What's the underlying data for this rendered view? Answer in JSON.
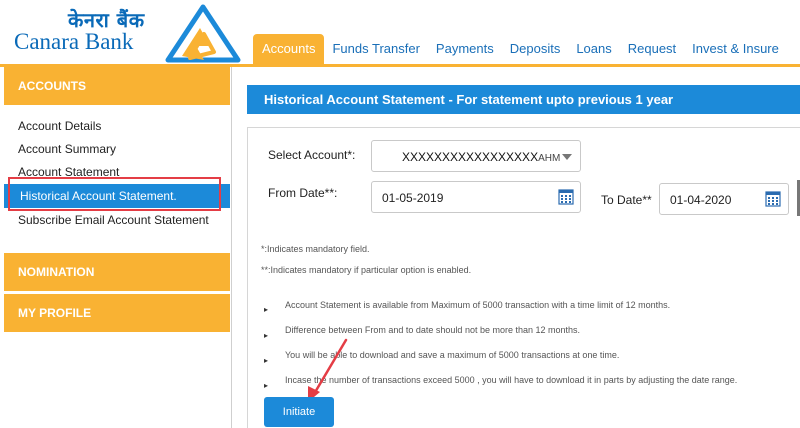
{
  "brand": {
    "name_hindi": "केनरा बैंक",
    "name_en": "Canara Bank",
    "colors": {
      "primary": "#1c8ad9",
      "accent": "#f9b233",
      "text_blue": "#0a6ab8",
      "highlight_red": "#e43d45"
    }
  },
  "nav": {
    "items": [
      {
        "label": "Accounts",
        "active": true
      },
      {
        "label": "Funds Transfer",
        "active": false
      },
      {
        "label": "Payments",
        "active": false
      },
      {
        "label": "Deposits",
        "active": false
      },
      {
        "label": "Loans",
        "active": false
      },
      {
        "label": "Request",
        "active": false
      },
      {
        "label": "Invest & Insure",
        "active": false
      }
    ]
  },
  "sidebar": {
    "accounts_header": "ACCOUNTS",
    "items": [
      {
        "label": "Account Details"
      },
      {
        "label": "Account Summary"
      },
      {
        "label": "Account Statement"
      },
      {
        "label": "Historical Account Statement.",
        "active": true
      },
      {
        "label": "Subscribe Email Account Statement"
      }
    ],
    "nomination_header": "NOMINATION",
    "profile_header": "MY PROFILE"
  },
  "main": {
    "title": "Historical Account Statement - For statement upto previous 1 year",
    "select_account_label": "Select Account*:",
    "select_account_value": "XXXXXXXXXXXXXXXXX",
    "select_account_suffix": "AHM",
    "from_date_label": "From Date**:",
    "from_date_value": "01-05-2019",
    "to_date_label": "To Date**",
    "to_date_value": "01-04-2020",
    "notes": [
      "*:Indicates mandatory field.",
      "**:Indicates mandatory if particular option is enabled."
    ],
    "bullets": [
      "Account Statement is available from Maximum of 5000 transaction with a time limit of 12 months.",
      "Difference between From and to date should not be more than 12 months.",
      "You will be able to download and save a maximum of 5000 transactions at one time.",
      "Incase the number of transactions exceed 5000 , you will have to download it in parts by adjusting the date range."
    ],
    "bullet_glyph": "▸",
    "initiate_label": "Initiate"
  }
}
